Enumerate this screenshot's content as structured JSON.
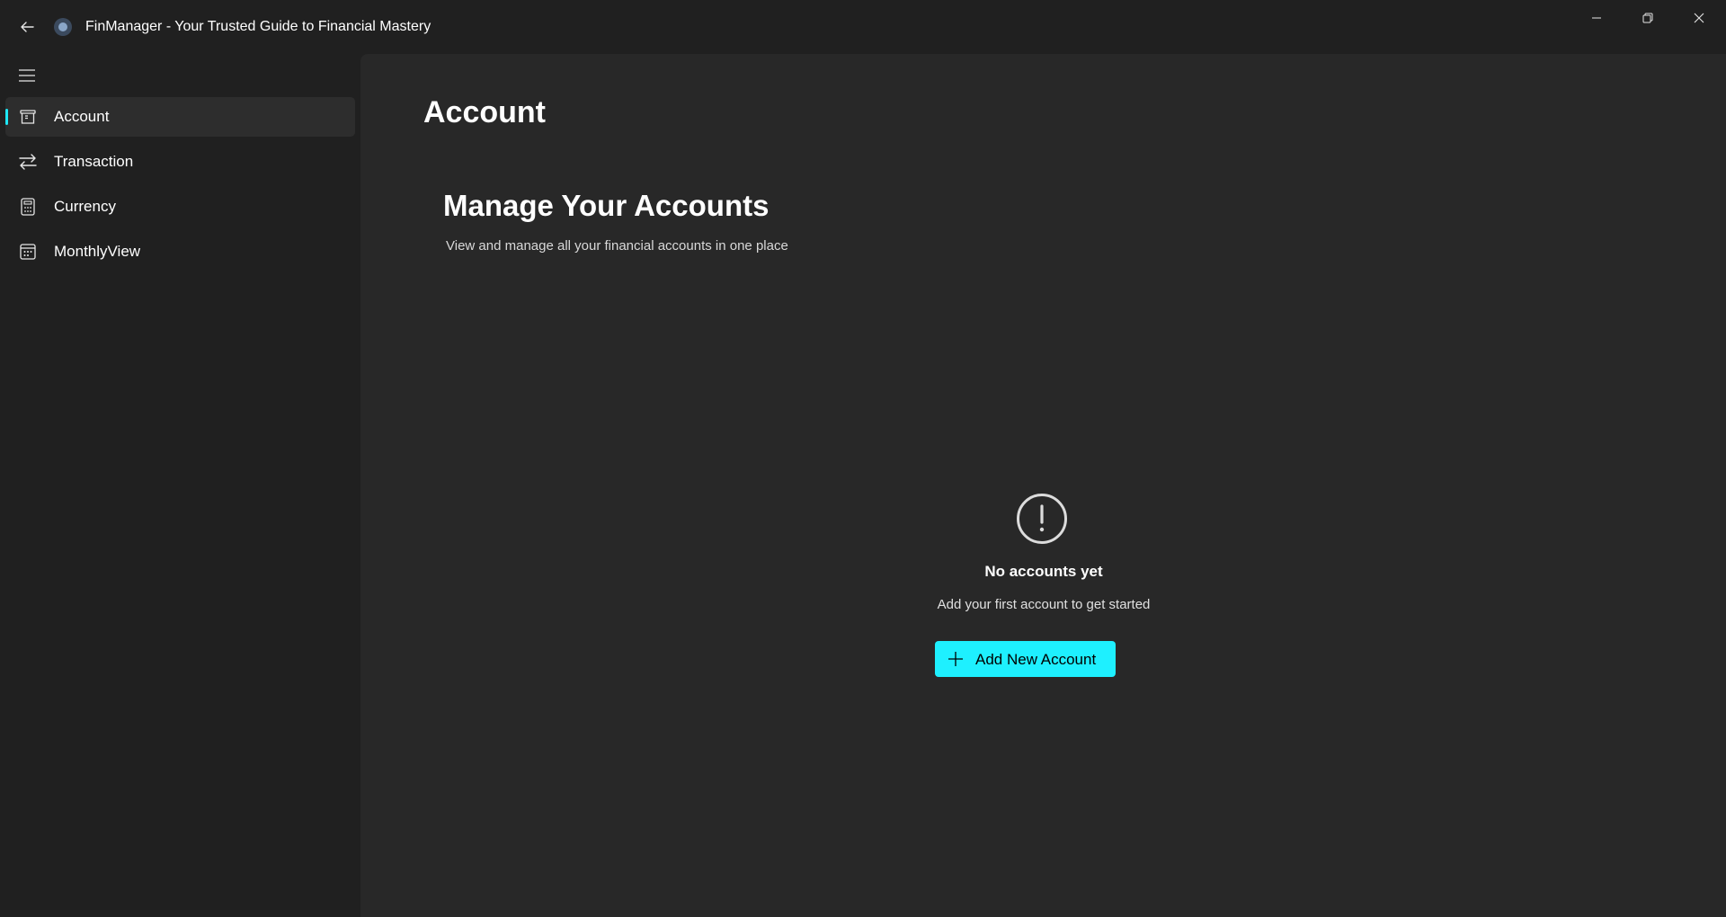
{
  "window": {
    "title": "FinManager - Your Trusted Guide to Financial Mastery"
  },
  "sidebar": {
    "items": [
      {
        "label": "Account",
        "icon": "account-card-icon",
        "selected": true
      },
      {
        "label": "Transaction",
        "icon": "swap-arrows-icon",
        "selected": false
      },
      {
        "label": "Currency",
        "icon": "calculator-icon",
        "selected": false
      },
      {
        "label": "MonthlyView",
        "icon": "calendar-icon",
        "selected": false
      }
    ]
  },
  "main": {
    "page_title": "Account",
    "section_title": "Manage Your Accounts",
    "section_subtitle": "View and manage all your financial accounts in one place",
    "empty_state": {
      "icon": "exclamation-circle-icon",
      "title": "No accounts yet",
      "subtitle": "Add your first account to get started"
    },
    "add_button_label": "Add New Account"
  },
  "colors": {
    "accent": "#1ef0ff",
    "indicator": "#1ee8f5",
    "background": "#202020",
    "content_background": "#282828"
  }
}
